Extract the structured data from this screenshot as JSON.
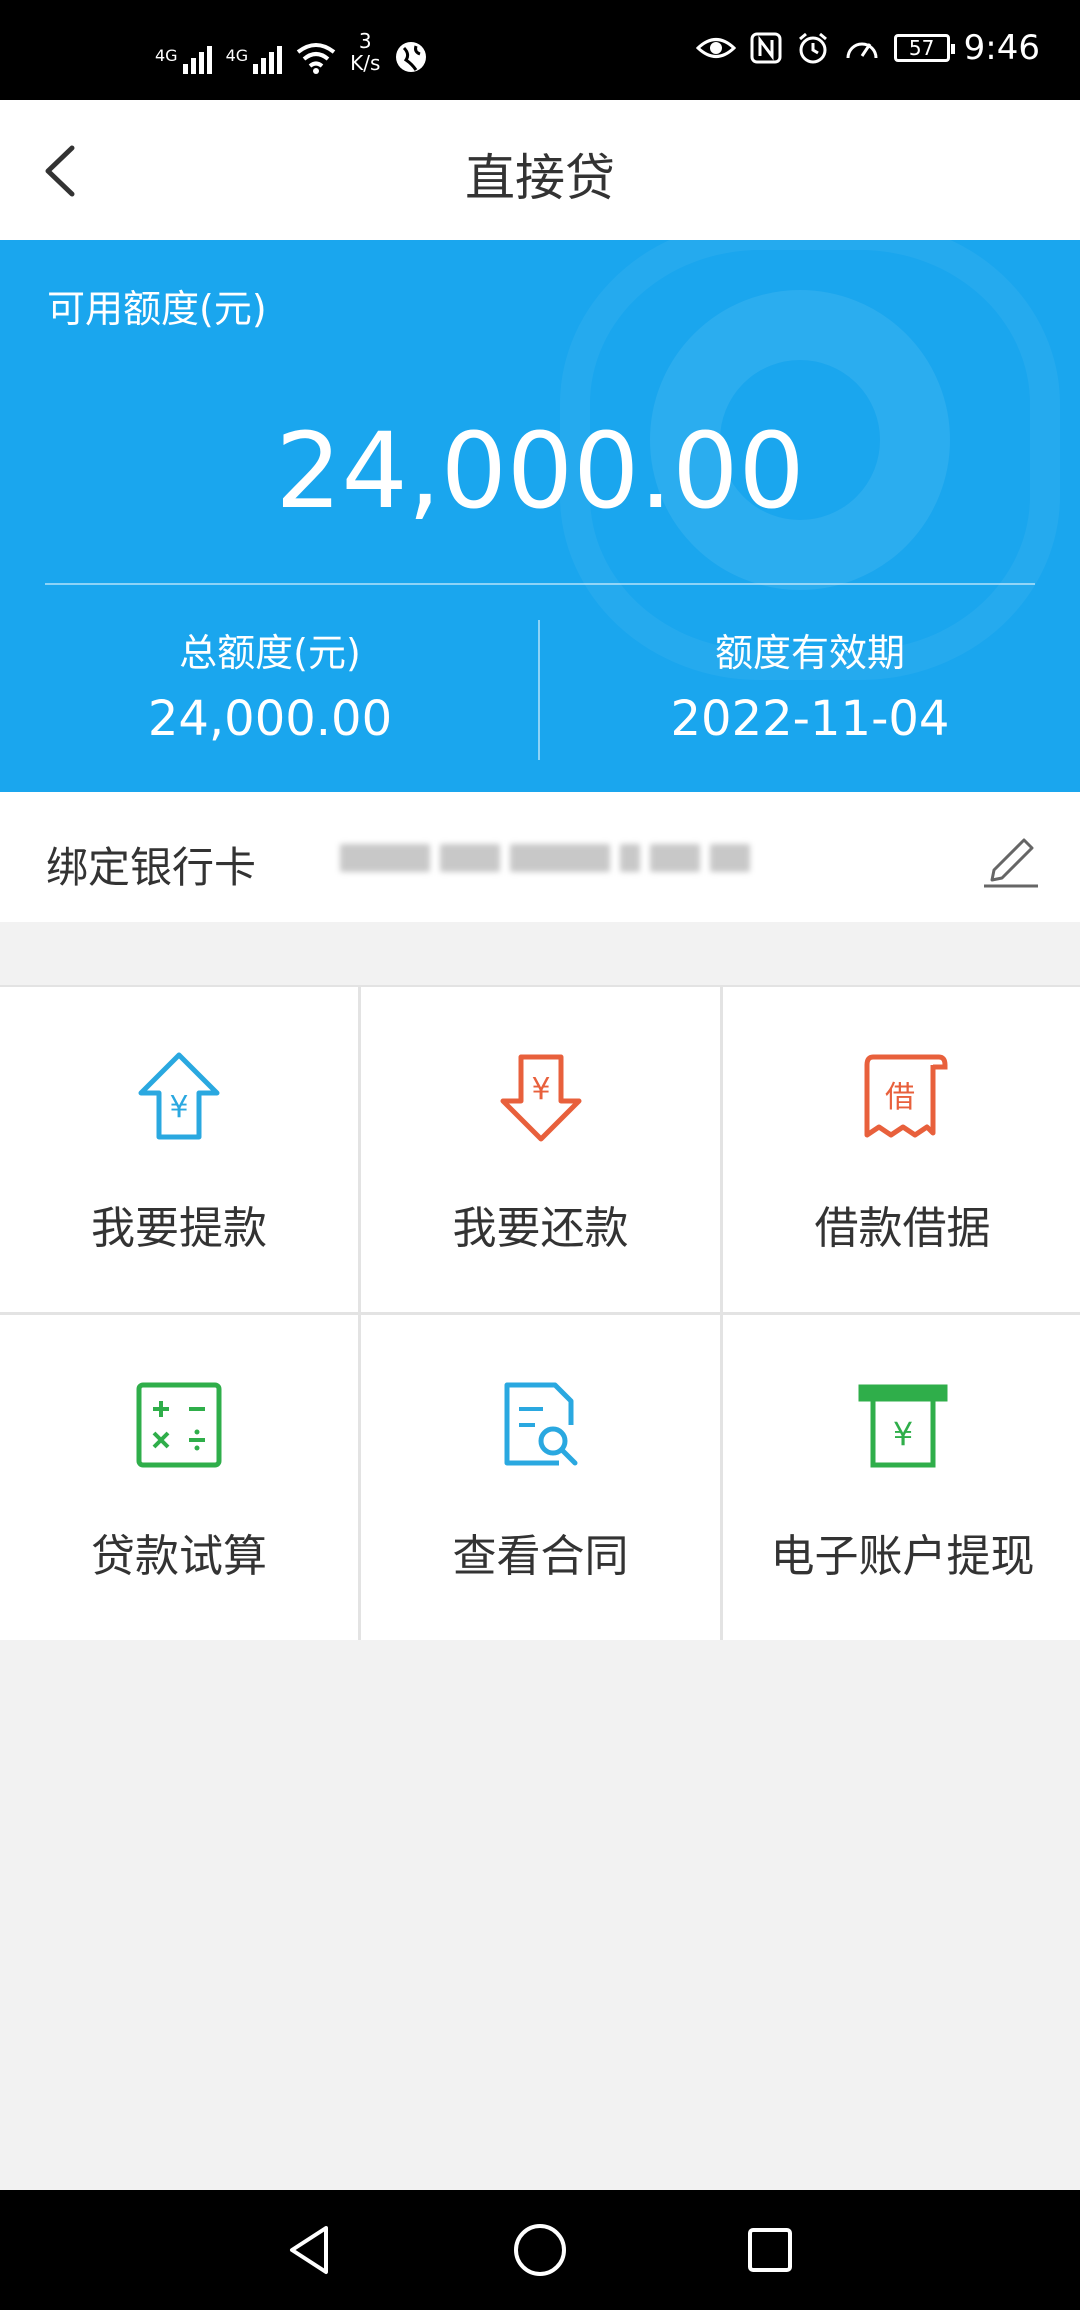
{
  "status_bar": {
    "net1": "4G",
    "net2": "4G",
    "speed_value": "3",
    "speed_unit": "K/s",
    "battery": "57",
    "time": "9:46",
    "icons": [
      "signal-icon",
      "wifi-icon",
      "globe-icon",
      "eye-icon",
      "nfc-icon",
      "alarm-icon",
      "speedometer-icon",
      "battery-icon"
    ]
  },
  "header": {
    "title": "直接贷",
    "back_icon": "back-arrow-icon"
  },
  "credit": {
    "available_label": "可用额度(元)",
    "available_amount": "24,000.00",
    "total_label": "总额度(元)",
    "total_value": "24,000.00",
    "validity_label": "额度有效期",
    "validity_value": "2022-11-04"
  },
  "bank": {
    "label": "绑定银行卡",
    "edit_icon": "pencil-icon"
  },
  "actions": [
    {
      "label": "我要提款",
      "icon": "withdraw-yuan-icon",
      "color": "#2aa8e0"
    },
    {
      "label": "我要还款",
      "icon": "repay-yuan-icon",
      "color": "#e8603c"
    },
    {
      "label": "借款借据",
      "icon": "receipt-icon",
      "color": "#e8603c",
      "glyph": "借"
    },
    {
      "label": "贷款试算",
      "icon": "calculator-icon",
      "color": "#2fae4a"
    },
    {
      "label": "查看合同",
      "icon": "contract-search-icon",
      "color": "#2aa8e0"
    },
    {
      "label": "电子账户提现",
      "icon": "atm-withdraw-icon",
      "color": "#2fae4a"
    }
  ],
  "colors": {
    "card_blue": "#1aa6ee",
    "page_bg": "#f2f2f2"
  },
  "nav": {
    "icons": [
      "nav-back-icon",
      "nav-home-icon",
      "nav-recents-icon"
    ]
  }
}
